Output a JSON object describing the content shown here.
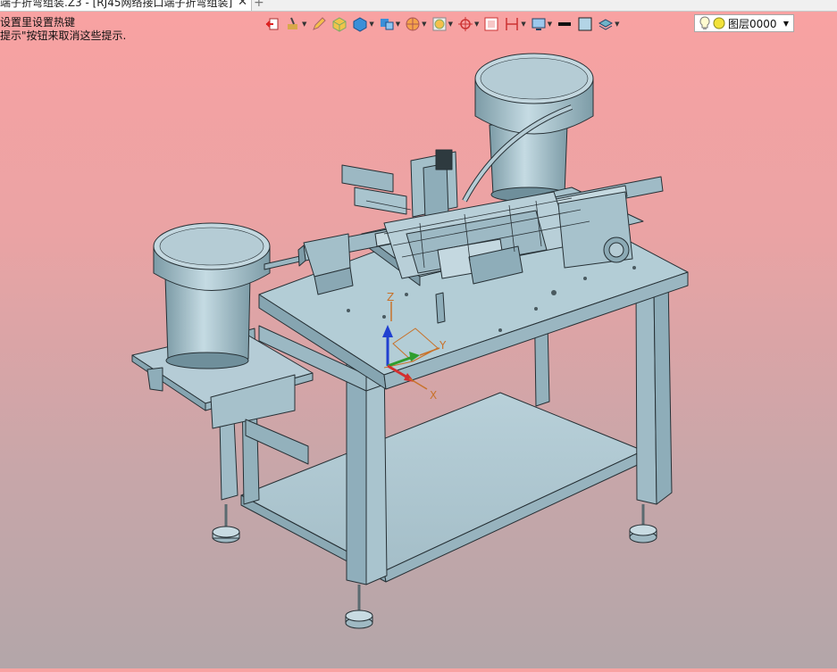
{
  "tab": {
    "title": "端子折弯组装.Z3 - [RJ45网络接口端子折弯组装]",
    "close_glyph": "✕",
    "new_glyph": "+"
  },
  "hint": {
    "line1": "设置里设置热键",
    "line2": "提示\"按钮来取消这些提示."
  },
  "toolbar": {
    "layer_name": "图层0000"
  },
  "axes": {
    "x": "X",
    "y": "Y",
    "z": "Z"
  },
  "colors": {
    "bg_top": "#f9a2a2",
    "bg_bottom": "#b3a6a9",
    "model": "#a9c4ce",
    "model_dark": "#7f9ea9",
    "model_edge": "#2a3338",
    "axis_x": "#d32f2f",
    "axis_y": "#2e9e2e",
    "axis_z": "#2040d0",
    "axis_label": "#c8722a"
  }
}
